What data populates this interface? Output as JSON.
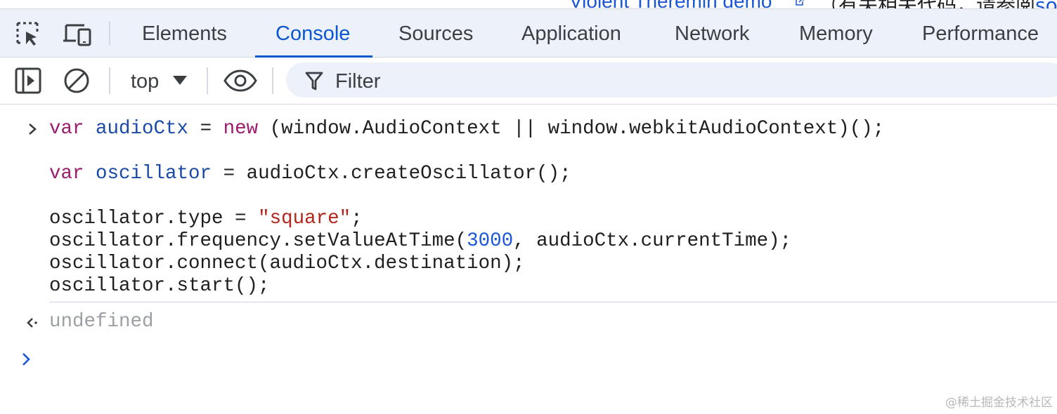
{
  "page_behind": {
    "link_text": "Violent Theremin demo",
    "rest_text": "（有关相关代码，请参阅",
    "rest_link": "sou"
  },
  "tabbar": {
    "tabs": [
      {
        "label": "Elements"
      },
      {
        "label": "Console",
        "active": true
      },
      {
        "label": "Sources"
      },
      {
        "label": "Application"
      },
      {
        "label": "Network"
      },
      {
        "label": "Memory"
      },
      {
        "label": "Performance"
      }
    ]
  },
  "toolbar": {
    "context": "top",
    "filter_placeholder": "Filter"
  },
  "console": {
    "input": {
      "line1": {
        "kw1": "var",
        "var1": "audioCtx",
        "t1": " = ",
        "kw2": "new",
        "t2": " (window.AudioContext || window.webkitAudioContext)();"
      },
      "line2": {
        "kw1": "var",
        "var1": "oscillator",
        "t1": " = audioCtx.createOscillator();"
      },
      "line3": {
        "t1": "oscillator.type = ",
        "str": "\"square\"",
        "t2": ";"
      },
      "line4": {
        "t1": "oscillator.frequency.setValueAtTime(",
        "num": "3000",
        "t2": ", audioCtx.currentTime);"
      },
      "line5": "oscillator.connect(audioCtx.destination);",
      "line6": "oscillator.start();"
    },
    "result": "undefined"
  },
  "watermark": "@稀土掘金技术社区",
  "colors": {
    "accent": "#0b57d0",
    "keyword": "#9c1d6c",
    "variable": "#1a4aa8",
    "string": "#b3261e",
    "number": "#1a56d6",
    "muted": "#9aa0a6"
  }
}
